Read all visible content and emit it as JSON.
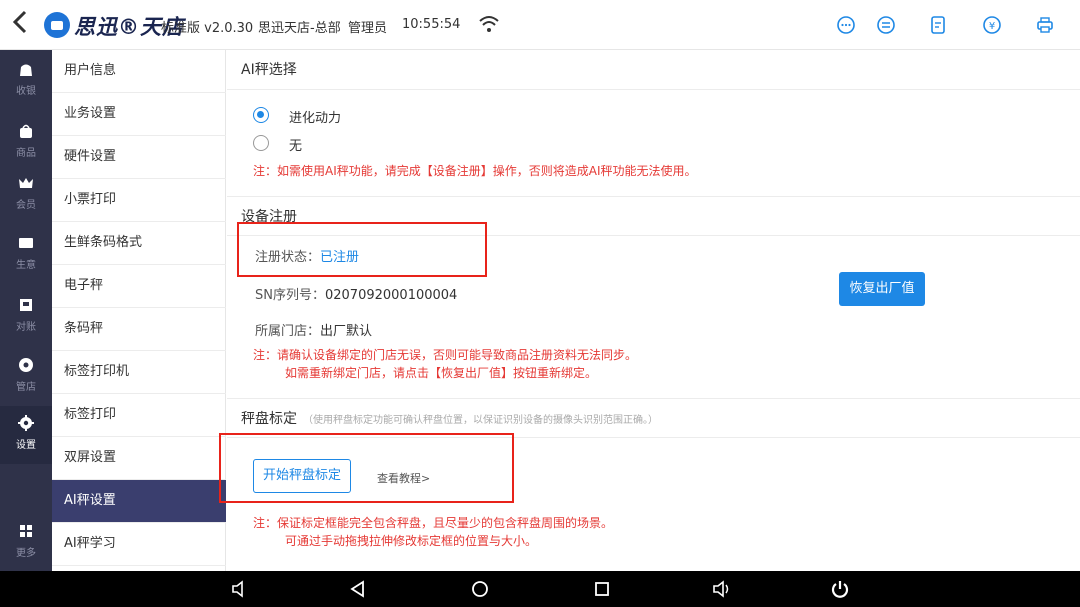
{
  "header": {
    "logo_text": "思迅®天店",
    "edition": "标准版 v2.0.30",
    "store": "思迅天店-总部",
    "role": "管理员",
    "time": "10:55:54",
    "icons": [
      "chat-icon",
      "exchange-icon",
      "document-icon",
      "yen-icon",
      "printer-icon"
    ]
  },
  "rail": [
    {
      "label": "收银",
      "icon": "cashier-bag-icon"
    },
    {
      "label": "商品",
      "icon": "product-bag-icon"
    },
    {
      "label": "会员",
      "icon": "crown-icon"
    },
    {
      "label": "生意",
      "icon": "business-icon"
    },
    {
      "label": "对账",
      "icon": "ledger-icon"
    },
    {
      "label": "管店",
      "icon": "store-icon"
    },
    {
      "label": "设置",
      "icon": "gear-icon"
    },
    {
      "label": "更多",
      "icon": "grid-icon"
    }
  ],
  "menu": [
    "用户信息",
    "业务设置",
    "硬件设置",
    "小票打印",
    "生鲜条码格式",
    "电子秤",
    "条码秤",
    "标签打印机",
    "标签打印",
    "双屏设置",
    "AI秤设置",
    "AI秤学习"
  ],
  "ai_scale": {
    "title": "AI秤选择",
    "options": [
      "进化动力",
      "无"
    ],
    "selected": "进化动力",
    "note": "注：如需使用AI秤功能，请完成【设备注册】操作，否则将造成AI秤功能无法使用。"
  },
  "registration": {
    "title": "设备注册",
    "status_label": "注册状态：",
    "status_value": "已注册",
    "sn_label": "SN序列号：",
    "sn_value": "0207092000100004",
    "store_label": "所属门店：",
    "store_value": "出厂默认",
    "restore_button": "恢复出厂值",
    "note_line1": "注：请确认设备绑定的门店无误，否则可能导致商品注册资料无法同步。",
    "note_line2": "如需重新绑定门店，请点击【恢复出厂值】按钮重新绑定。"
  },
  "calibration": {
    "title": "秤盘标定",
    "hint": "（使用秤盘标定功能可确认秤盘位置，以保证识别设备的摄像头识别范围正确。）",
    "start_button": "开始秤盘标定",
    "tutorial_link": "查看教程>",
    "note_line1": "注：保证标定框能完全包含秤盘，且尽量少的包含秤盘周围的场景。",
    "note_line2": "可通过手动拖拽拉伸修改标定框的位置与大小。"
  },
  "colors": {
    "accent": "#1e88e5",
    "warning": "#e53935",
    "rail_bg": "#2f3249",
    "menu_active": "#3a3e6e",
    "highlight_box": "#e8231a"
  }
}
